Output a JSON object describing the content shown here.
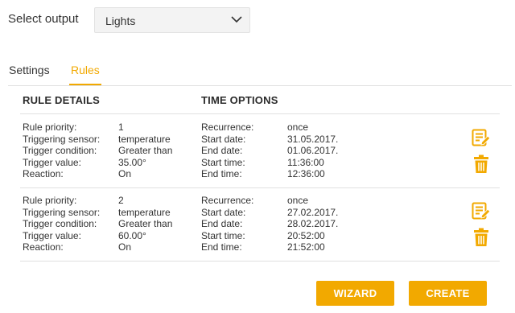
{
  "output_selector": {
    "label": "Select output",
    "value": "Lights"
  },
  "tabs": [
    {
      "label": "Settings",
      "active": false
    },
    {
      "label": "Rules",
      "active": true
    }
  ],
  "columns": {
    "rule_details": "RULE DETAILS",
    "time_options": "TIME OPTIONS"
  },
  "rules": [
    {
      "rule_details": [
        {
          "label": "Rule priority:",
          "value": "1"
        },
        {
          "label": "Triggering sensor:",
          "value": "temperature"
        },
        {
          "label": "Trigger condition:",
          "value": "Greater than"
        },
        {
          "label": "Trigger value:",
          "value": "35.00°"
        },
        {
          "label": "Reaction:",
          "value": "On"
        }
      ],
      "time_options": [
        {
          "label": "Recurrence:",
          "value": "once"
        },
        {
          "label": "Start date:",
          "value": "31.05.2017."
        },
        {
          "label": "End date:",
          "value": "01.06.2017."
        },
        {
          "label": "Start time:",
          "value": "11:36:00"
        },
        {
          "label": "End time:",
          "value": "12:36:00"
        }
      ]
    },
    {
      "rule_details": [
        {
          "label": "Rule priority:",
          "value": "2"
        },
        {
          "label": "Triggering sensor:",
          "value": "temperature"
        },
        {
          "label": "Trigger condition:",
          "value": "Greater than"
        },
        {
          "label": "Trigger value:",
          "value": "60.00°"
        },
        {
          "label": "Reaction:",
          "value": "On"
        }
      ],
      "time_options": [
        {
          "label": "Recurrence:",
          "value": "once"
        },
        {
          "label": "Start date:",
          "value": "27.02.2017."
        },
        {
          "label": "End date:",
          "value": "28.02.2017."
        },
        {
          "label": "Start time:",
          "value": "20:52:00"
        },
        {
          "label": "End time:",
          "value": "21:52:00"
        }
      ]
    }
  ],
  "buttons": {
    "wizard": "WIZARD",
    "create": "CREATE"
  },
  "icons": {
    "edit": "edit-list-icon",
    "delete": "trash-icon",
    "dropdown": "chevron-down-icon"
  },
  "colors": {
    "accent": "#f2a900",
    "text": "#333333",
    "divider": "#e0e0e0",
    "select_bg": "#f3f3f3"
  }
}
